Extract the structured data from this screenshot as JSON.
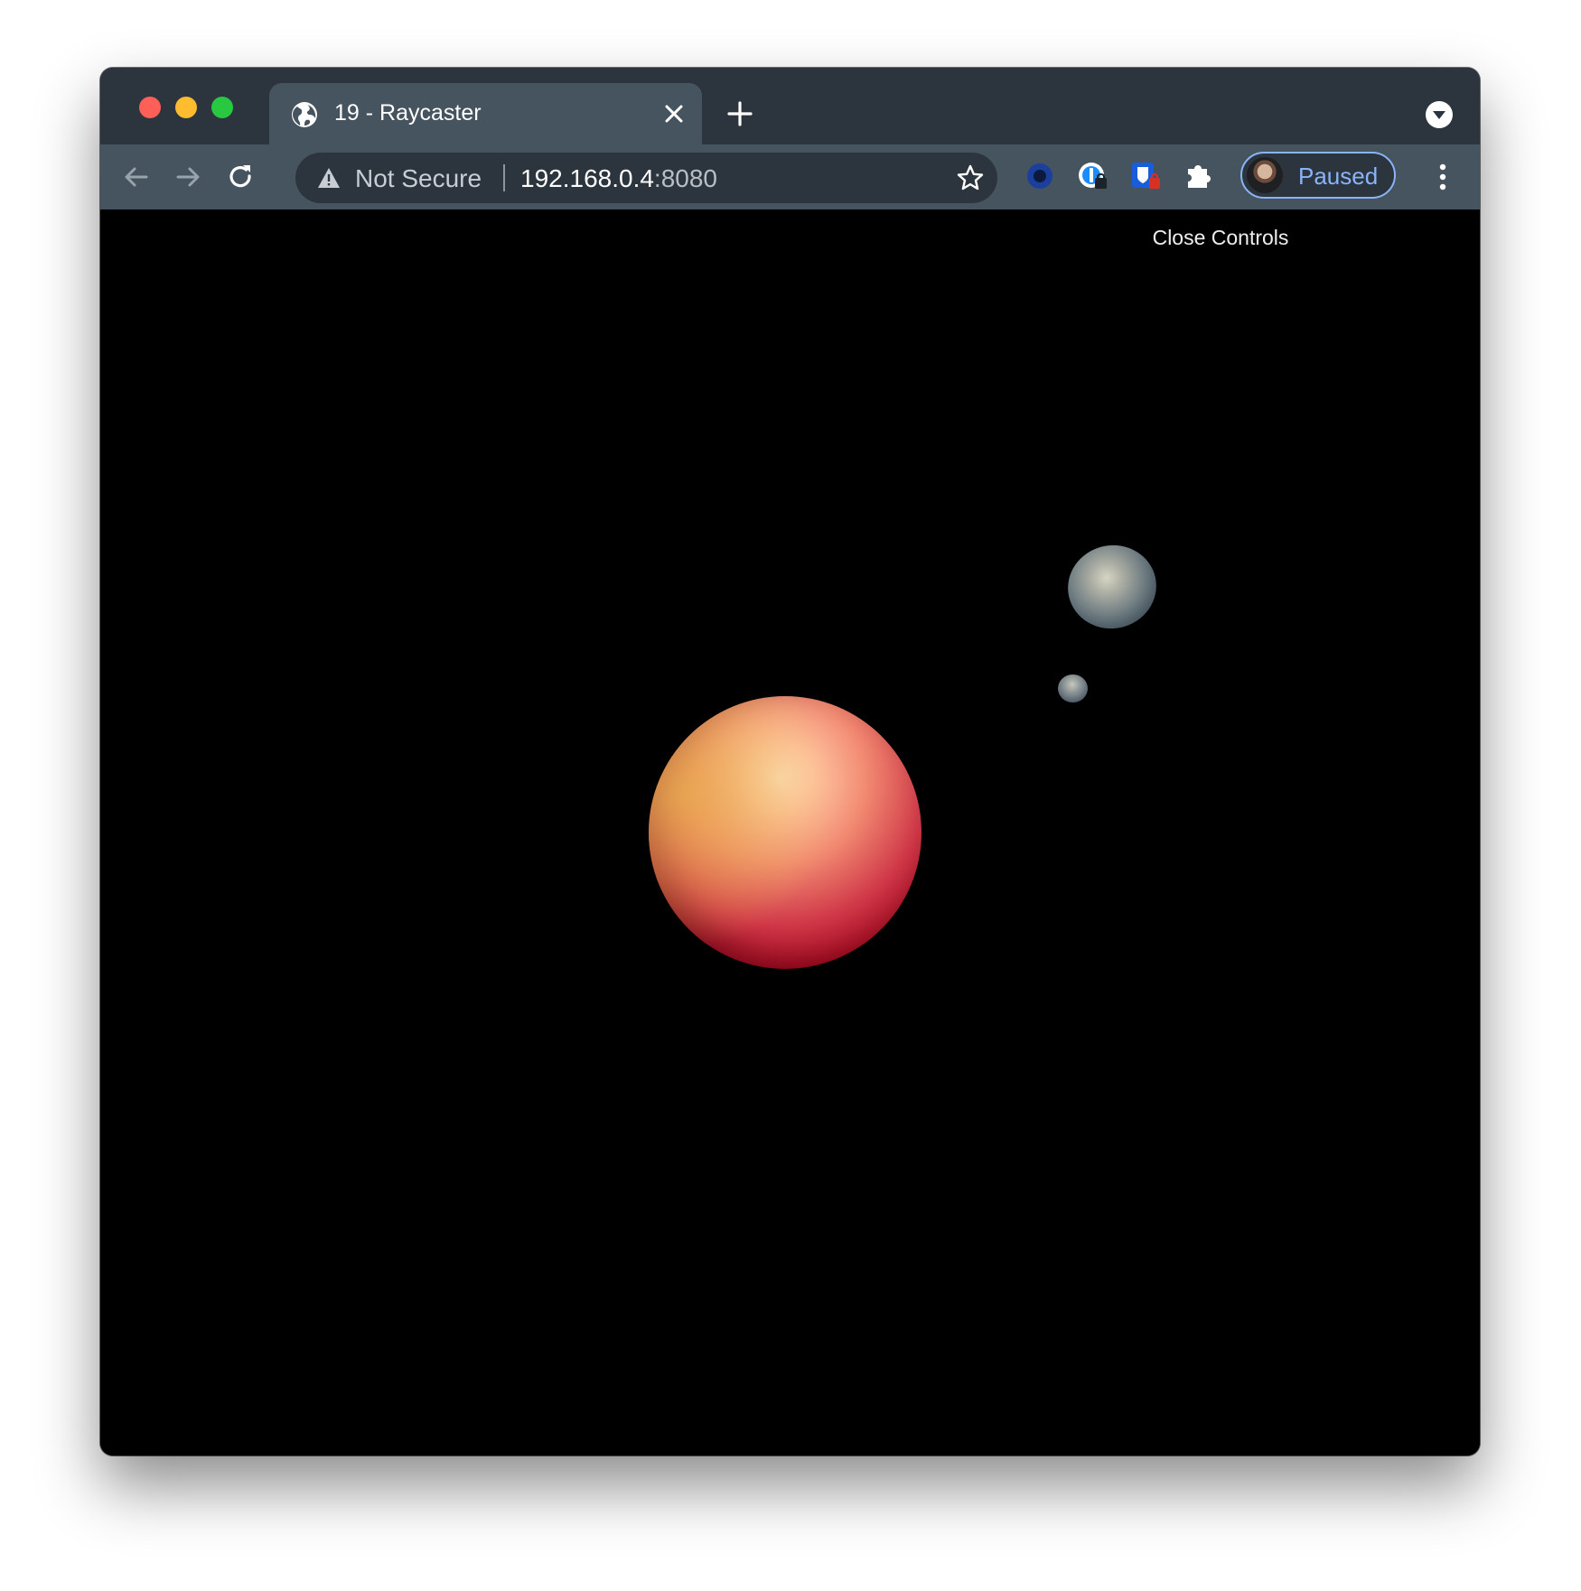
{
  "browser": {
    "tab": {
      "title": "19 - Raycaster",
      "favicon": "globe-icon"
    },
    "address_bar": {
      "security_label": "Not Secure",
      "url_host": "192.168.0.4",
      "url_port": ":8080"
    },
    "extensions": [
      "blue-ring-extension-icon",
      "password-manager-icon",
      "bitwarden-shield-icon",
      "extensions-puzzle-icon"
    ],
    "profile": {
      "label": "Paused",
      "avatar": "user-avatar"
    }
  },
  "page": {
    "controls_label": "Close Controls",
    "scene": {
      "objects": [
        {
          "name": "main-sphere",
          "colors": [
            "#ffe1c2",
            "#f28b72",
            "#d03848",
            "#a3061d",
            "#e8b249"
          ]
        },
        {
          "name": "large-moon",
          "colors": [
            "#d6d5c2",
            "#6c7a80",
            "#1d2933"
          ]
        },
        {
          "name": "small-moon",
          "colors": [
            "#c6c8bd",
            "#566470",
            "#2b3944"
          ]
        }
      ],
      "background": "#000000"
    }
  },
  "colors": {
    "titlebar": "#2c353d",
    "toolbar": "#45545f",
    "accent": "#8ab4f8"
  }
}
